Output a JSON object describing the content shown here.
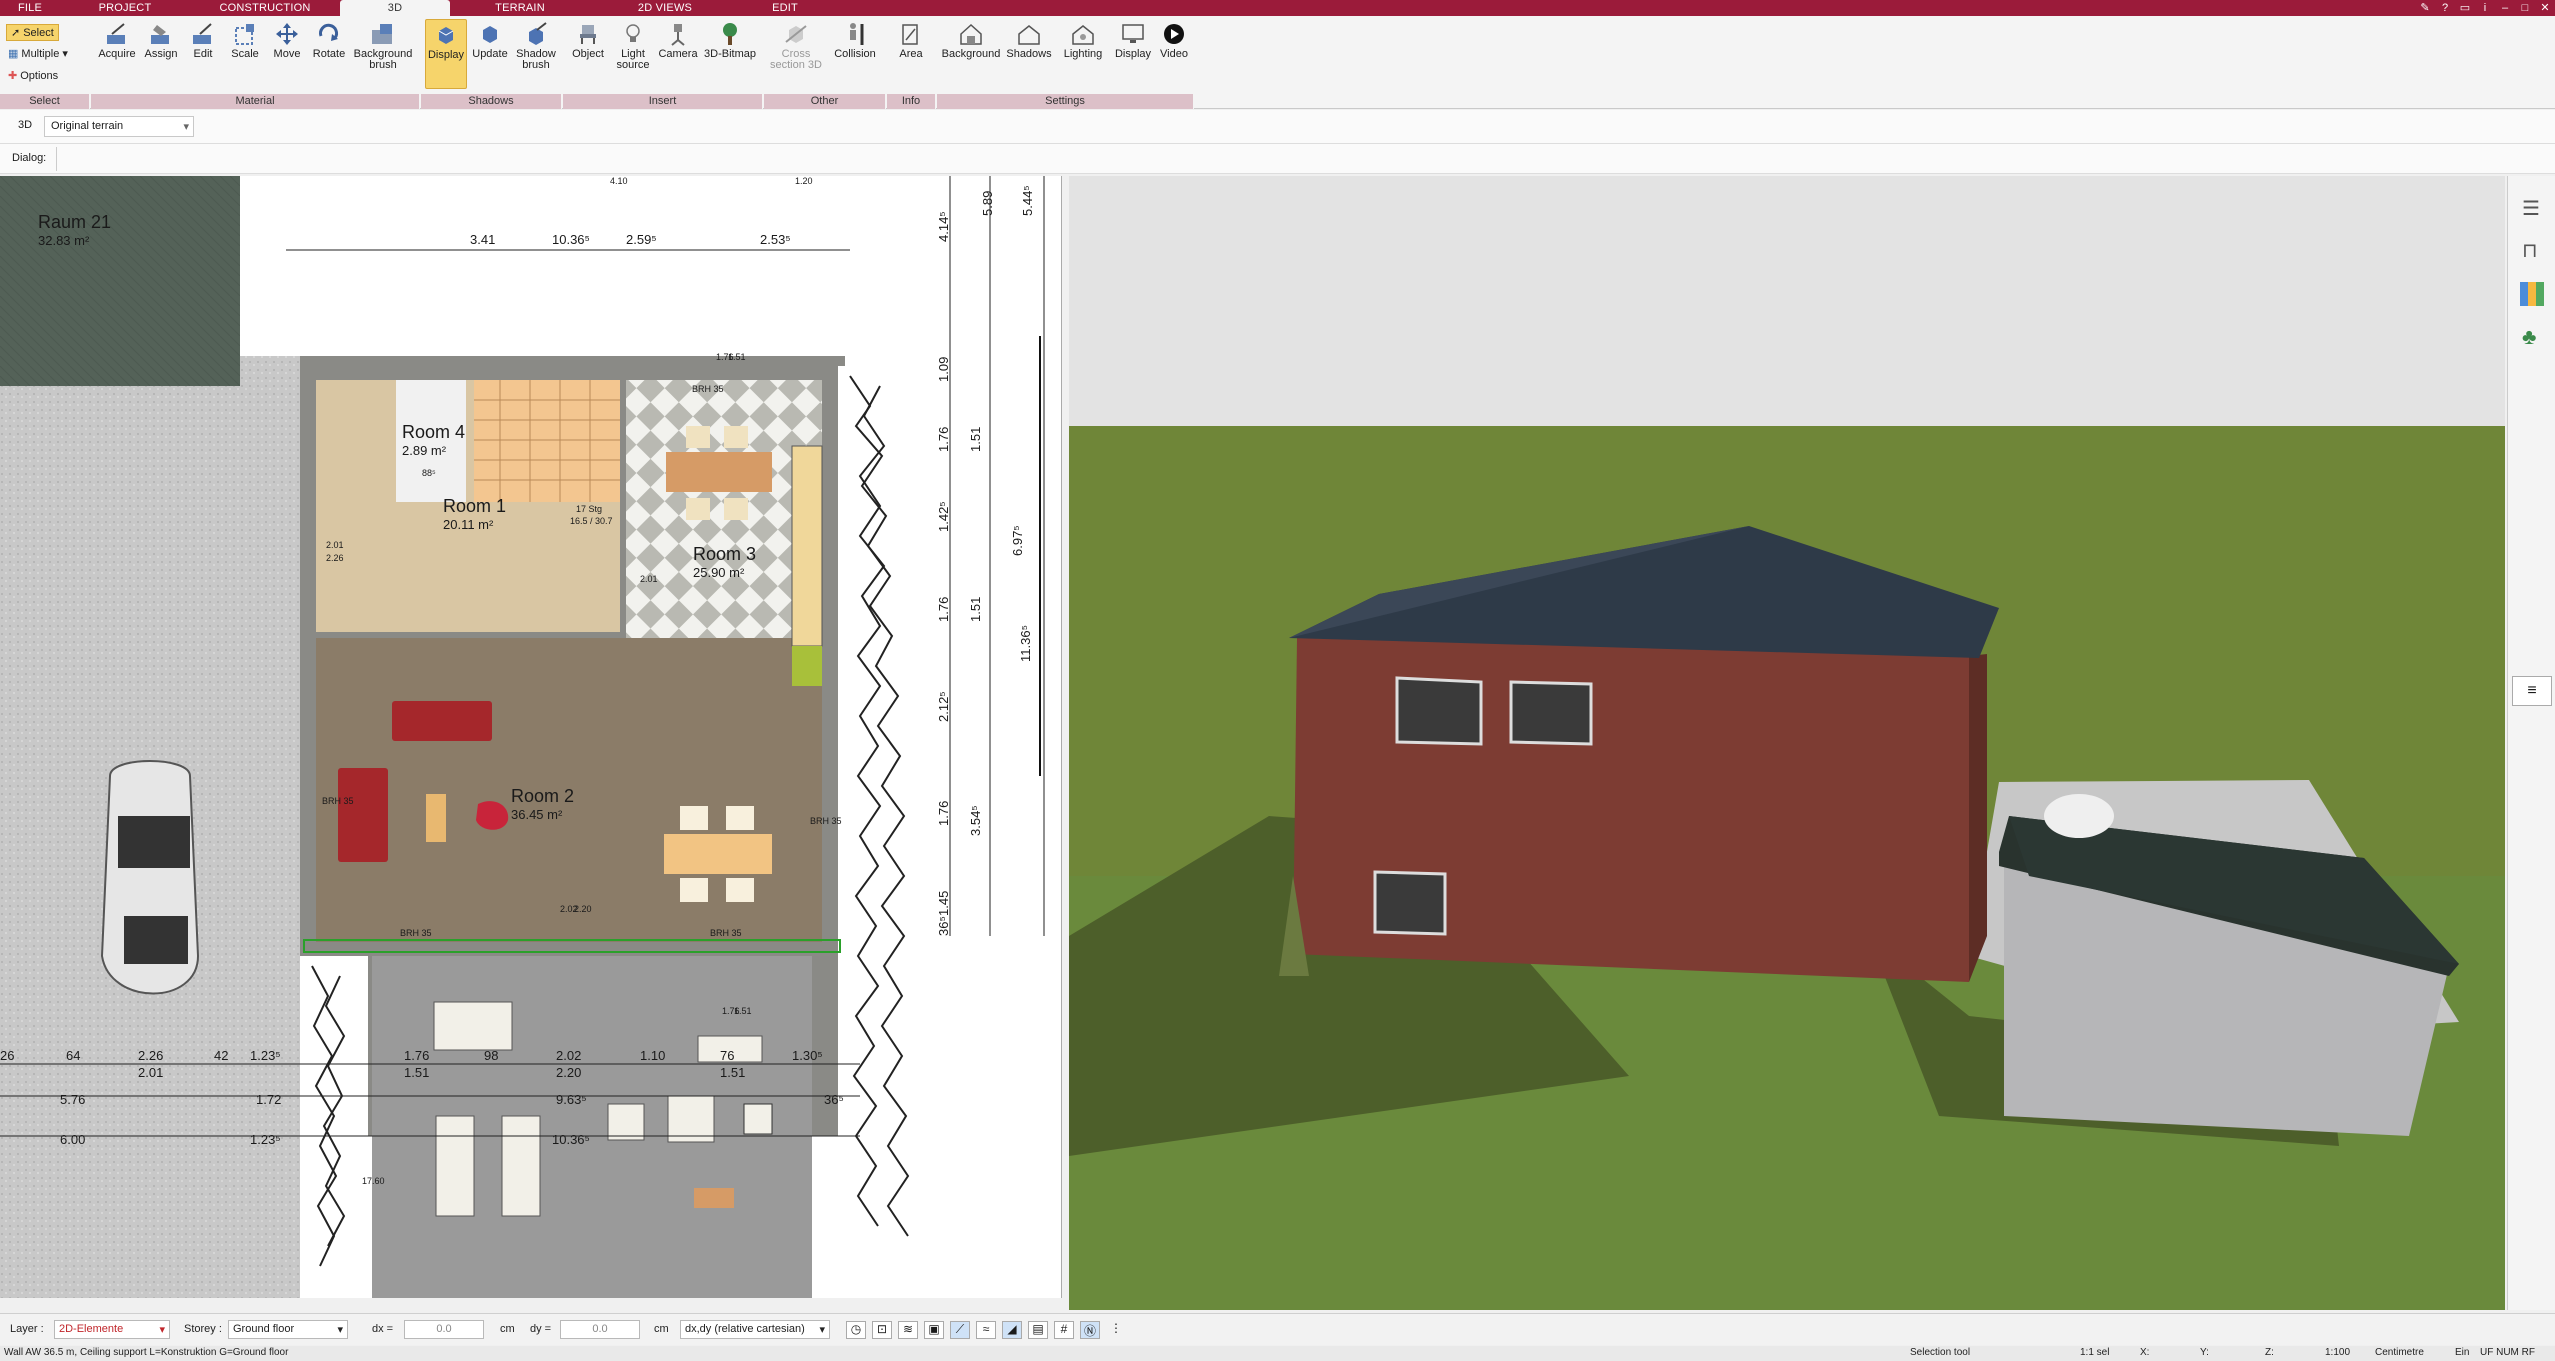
{
  "tabs": [
    {
      "label": "FILE",
      "active": false
    },
    {
      "label": "PROJECT",
      "active": false
    },
    {
      "label": "CONSTRUCTION",
      "active": false
    },
    {
      "label": "3D",
      "active": true
    },
    {
      "label": "TERRAIN",
      "active": false
    },
    {
      "label": "2D VIEWS",
      "active": false
    },
    {
      "label": "EDIT",
      "active": false
    }
  ],
  "ribbon": {
    "select_group": {
      "select": "Select",
      "multiple": "Multiple",
      "options": "Options",
      "label": "Select"
    },
    "material_group": {
      "label": "Material",
      "buttons": [
        "Acquire",
        "Assign",
        "Edit",
        "Scale",
        "Move",
        "Rotate",
        "Background brush"
      ]
    },
    "shadows_group": {
      "label": "Shadows",
      "buttons": [
        "Display",
        "Update",
        "Shadow brush"
      ]
    },
    "insert_group": {
      "label": "Insert",
      "buttons": [
        "Object",
        "Light source",
        "Camera",
        "3D-Bitmap"
      ]
    },
    "other_group": {
      "label": "Other",
      "buttons": [
        "Cross section 3D",
        "Collision"
      ]
    },
    "info_group": {
      "label": "Info",
      "buttons": [
        "Area"
      ]
    },
    "settings_group": {
      "label": "Settings",
      "buttons": [
        "Background",
        "Shadows",
        "Lighting",
        "Display",
        "Video"
      ]
    }
  },
  "bar2": {
    "mode": "3D",
    "terrain_select": "Original terrain"
  },
  "bar3": {
    "dialog_label": "Dialog:"
  },
  "plan": {
    "rooms": [
      {
        "name": "Raum 21",
        "area": "32.83 m²"
      },
      {
        "name": "Room 4",
        "area": "2.89 m²"
      },
      {
        "name": "Room 1",
        "area": "20.11 m²"
      },
      {
        "name": "Room 3",
        "area": "25.90 m²"
      },
      {
        "name": "Room 2",
        "area": "36.45 m²"
      }
    ],
    "top_dims": [
      "3.41",
      "10.36⁵",
      "2.59⁵",
      "2.53⁵"
    ],
    "side_dims": [
      "5.89",
      "5.44⁵",
      "4.14⁵",
      "1.09",
      "1.76",
      "1.51",
      "1.42⁵",
      "6.97⁵",
      "11.36⁵",
      "1.76",
      "1.51",
      "2.12⁵",
      "1.76",
      "3.54⁵",
      "1.45",
      "36⁵"
    ],
    "bottom_dims_row1": [
      "26",
      "64",
      "2.26",
      "42",
      "1.23⁵",
      "1.76",
      "98",
      "2.02",
      "1.10",
      "76",
      "1.30⁵"
    ],
    "bottom_dims_row1b": [
      "2.01",
      "1.51",
      "2.20",
      "1.51"
    ],
    "bottom_dims_row2": [
      "5.76",
      "1.72",
      "9.63⁵",
      "36⁵"
    ],
    "bottom_dims_row3": [
      "6.00",
      "1.23⁵",
      "10.36⁵"
    ],
    "misc_labels": [
      "BRH 35",
      "BRH 35",
      "BRH 35",
      "BRH 35",
      "BRH 35",
      "17.60",
      "2.01",
      "2.26",
      "88⁵",
      "2.01",
      "17 Stg",
      "16.5 / 30.7",
      "1.76",
      "1.51",
      "2.02",
      "2.20",
      "1.76",
      "1.51",
      "4.10",
      "1.20"
    ]
  },
  "statusbar": {
    "layer_label": "Layer :",
    "layer_value": "2D-Elemente",
    "storey_label": "Storey :",
    "storey_value": "Ground floor",
    "dx_label": "dx =",
    "dx_value": "0.0",
    "dy_label": "dy =",
    "dy_value": "0.0",
    "unit1": "cm",
    "unit2": "cm",
    "coord_mode": "dx,dy (relative cartesian)"
  },
  "infobar": {
    "message": "Wall AW 36.5 m, Ceiling support L=Konstruktion G=Ground floor",
    "tool": "Selection tool",
    "sel": "1:1 sel",
    "x": "X:",
    "y": "Y:",
    "z": "Z:",
    "scale": "1:100",
    "unit": "Centimetre",
    "ein": "Ein",
    "flags": "UF NUM RF"
  },
  "colors": {
    "accent": "#9b1b3a",
    "ribbon_group": "#dcc0c8",
    "active_btn": "#f6d46b",
    "grass": "#6a7f3a",
    "sky": "#e6e6e6",
    "roof": "#2e3844",
    "brick": "#7a3a30"
  }
}
